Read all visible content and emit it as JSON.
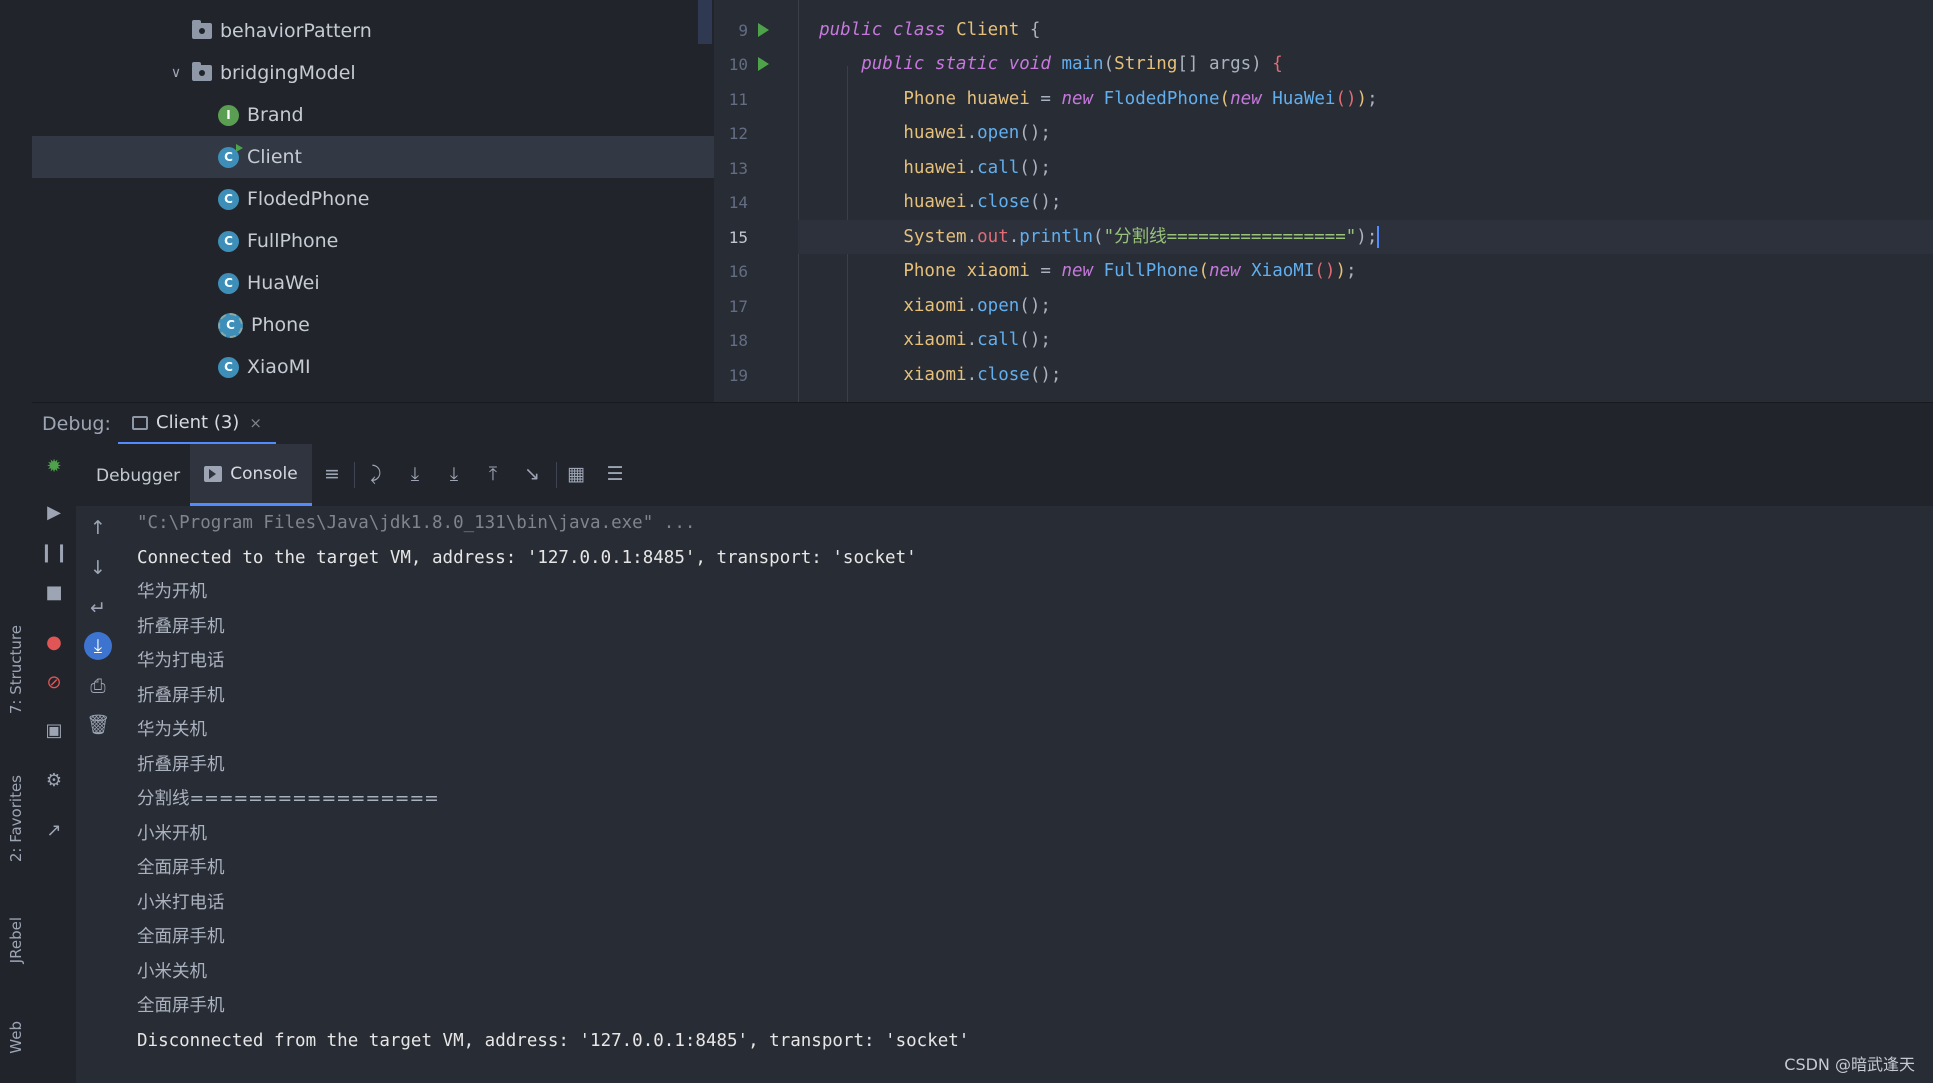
{
  "left_strip": {
    "structure": "7: Structure",
    "favorites": "2: Favorites",
    "jrebel": "JRebel",
    "web": "Web"
  },
  "project_tree": {
    "items": [
      {
        "label": "behaviorPattern",
        "kind": "folder",
        "expanded": false
      },
      {
        "label": "bridgingModel",
        "kind": "folder",
        "expanded": true
      },
      {
        "label": "Brand",
        "kind": "interface"
      },
      {
        "label": "Client",
        "kind": "class",
        "selected": true
      },
      {
        "label": "FlodedPhone",
        "kind": "class"
      },
      {
        "label": "FullPhone",
        "kind": "class"
      },
      {
        "label": "HuaWei",
        "kind": "class"
      },
      {
        "label": "Phone",
        "kind": "abstract-class"
      },
      {
        "label": "XiaoMI",
        "kind": "class"
      }
    ]
  },
  "editor": {
    "current_line": "15",
    "line_numbers": [
      "9",
      "10",
      "11",
      "12",
      "13",
      "14",
      "15",
      "16",
      "17",
      "18",
      "19"
    ],
    "lines": [
      "public class Client {",
      "    public static void main(String[] args) {",
      "        Phone huawei = new FlodedPhone(new HuaWei());",
      "        huawei.open();",
      "        huawei.call();",
      "        huawei.close();",
      "        System.out.println(\"分割线=================\");",
      "        Phone xiaomi = new FullPhone(new XiaoMI());",
      "        xiaomi.open();",
      "        xiaomi.call();",
      "        xiaomi.close();"
    ],
    "separator_string": "\"分割线=================\""
  },
  "debug": {
    "label": "Debug:",
    "tab_label": "Client (3)",
    "close_glyph": "×",
    "subtabs": {
      "debugger": "Debugger",
      "console": "Console"
    }
  },
  "console": {
    "command": "\"C:\\Program Files\\Java\\jdk1.8.0_131\\bin\\java.exe\" ...",
    "connected": "Connected to the target VM, address: '127.0.0.1:8485', transport: 'socket'",
    "output": [
      "华为开机",
      "折叠屏手机",
      "华为打电话",
      "折叠屏手机",
      "华为关机",
      "折叠屏手机",
      "分割线=================",
      "小米开机",
      "全面屏手机",
      "小米打电话",
      "全面屏手机",
      "小米关机",
      "全面屏手机"
    ],
    "disconnected": "Disconnected from the target VM, address: '127.0.0.1:8485', transport: 'socket'"
  },
  "watermark": "CSDN @暗武逢天",
  "colors": {
    "accent": "#528bff",
    "keyword": "#c678dd",
    "type": "#e5c07b",
    "function": "#61afef",
    "string": "#98c379",
    "run_arrow": "#4ea34a"
  }
}
